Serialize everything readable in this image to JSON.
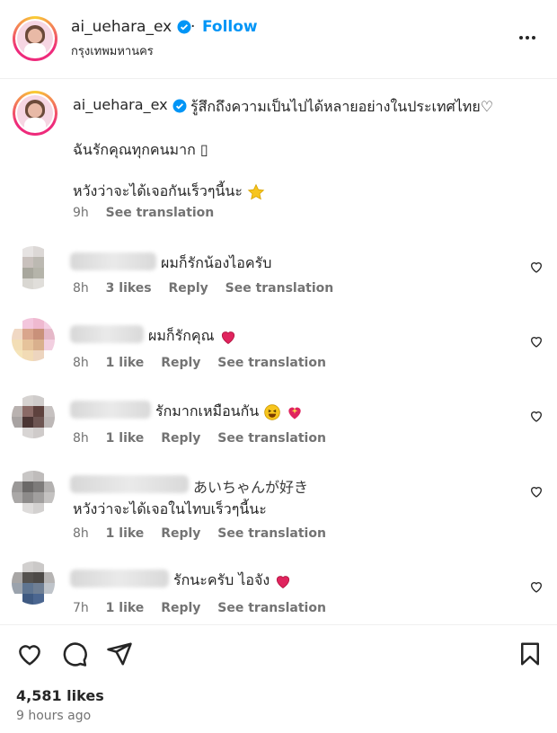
{
  "header": {
    "username": "ai_uehara_ex",
    "separator": "·",
    "follow_label": "Follow",
    "location": "กรุงเทพมหานคร",
    "more_icon": "more-horizontal-icon"
  },
  "caption": {
    "username": "ai_uehara_ex",
    "line1": "รู้สึกถึงความเป็นไปได้หลายอย่างในประเทศไทย♡",
    "line2": "ฉันรักคุณทุกคนมาก ▯",
    "line3": "หวังว่าจะได้เจอกันเร็วๆนี้นะ",
    "time": "9h",
    "translate": "See translation"
  },
  "comments": [
    {
      "text": "ผมก็รักน้องไอครับ",
      "time": "8h",
      "likes": "3 likes",
      "reply": "Reply",
      "translate": "See translation"
    },
    {
      "text": "ผมก็รักคุณ",
      "time": "8h",
      "likes": "1 like",
      "reply": "Reply",
      "translate": "See translation"
    },
    {
      "text": "รักมากเหมือนกัน",
      "time": "8h",
      "likes": "1 like",
      "reply": "Reply",
      "translate": "See translation"
    },
    {
      "text_top": "あいちゃんが好き",
      "text": "หวังว่าจะได้เจอในไทบเร็วๆนี้นะ",
      "time": "8h",
      "likes": "1 like",
      "reply": "Reply",
      "translate": "See translation"
    },
    {
      "text": "รักนะครับ ไอจัง",
      "time": "7h",
      "likes": "1 like",
      "reply": "Reply",
      "translate": "See translation"
    }
  ],
  "footer": {
    "likes": "4,581 likes",
    "ago": "9 hours ago"
  },
  "colors": {
    "link": "#0095f6",
    "muted": "#737373",
    "heart": "#e0245e",
    "verified": "#0095f6"
  }
}
